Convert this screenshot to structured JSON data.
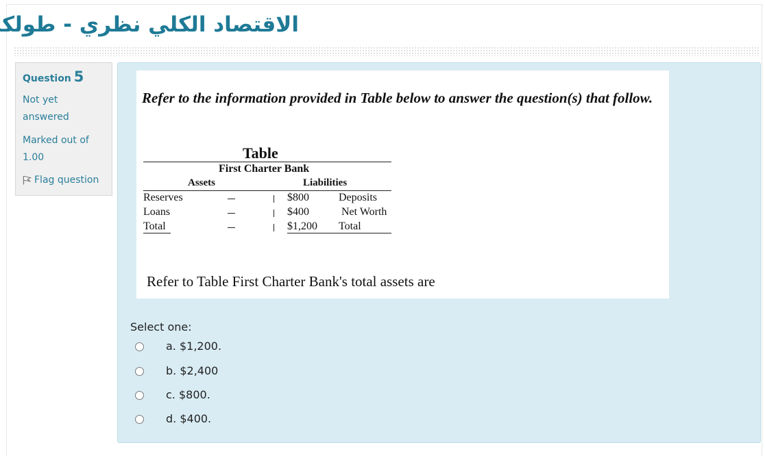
{
  "page": {
    "course_title": "الاقتصاد الكلي نظري - طولكرم"
  },
  "info": {
    "question_label": "Question",
    "question_number": "5",
    "state_line1": "Not yet",
    "state_line2": "answered",
    "grade_line1": "Marked out of",
    "grade_line2": "1.00",
    "flag_label": "Flag question",
    "flag_icon": "flag-icon"
  },
  "question": {
    "intro": "Refer to the information provided in Table below to answer the question(s) that follow.",
    "table": {
      "title": "Table",
      "bank_name": "First Charter Bank",
      "assets_header": "Assets",
      "liabilities_header": "Liabilities",
      "rows": [
        {
          "asset": "Reserves",
          "amount": "$800",
          "liability": "Deposits"
        },
        {
          "asset": "Loans",
          "amount": "$400",
          "liability": "Net Worth"
        },
        {
          "asset": "Total",
          "amount": "$1,200",
          "liability": "Total"
        }
      ]
    },
    "text": "Refer to Table First Charter Bank's total assets are",
    "prompt": "Select one:",
    "options": [
      {
        "label": "a. $1,200.",
        "selected": false
      },
      {
        "label": "b. $2,400",
        "selected": false
      },
      {
        "label": "c. $800.",
        "selected": false
      },
      {
        "label": "d. $400.",
        "selected": false
      }
    ]
  },
  "colors": {
    "accent": "#1e7a96",
    "info_bg": "#f0f0f0",
    "formulation_bg": "#d9ecf4"
  }
}
